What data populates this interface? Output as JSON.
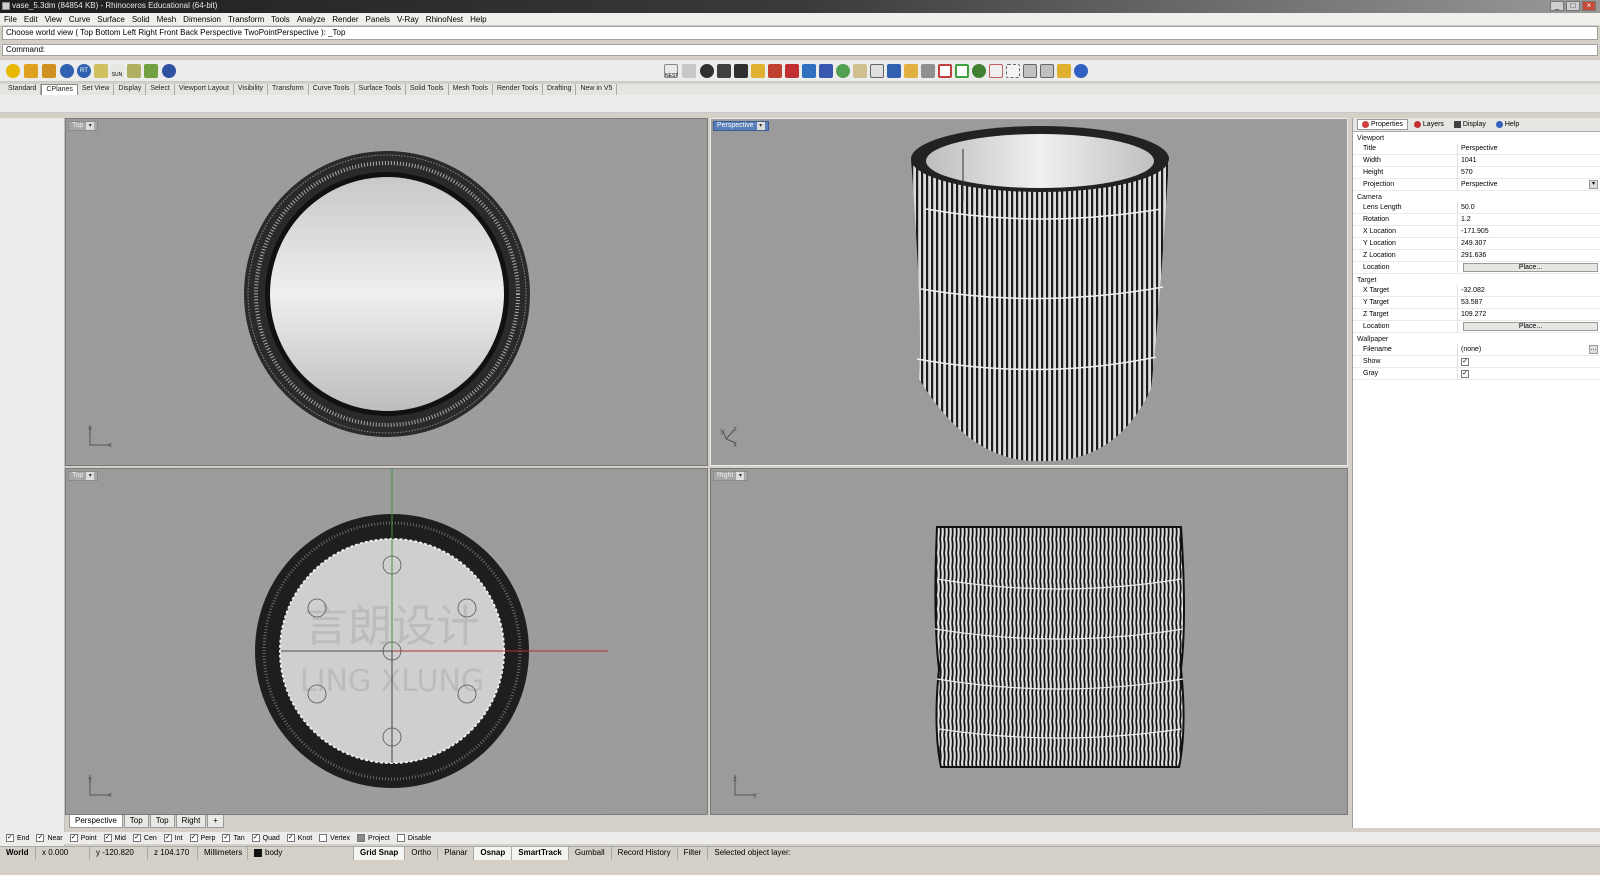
{
  "window": {
    "title": "vase_5.3dm (84854 KB) - Rhinoceros Educational (64-bit)",
    "controls": [
      "_",
      "□",
      "×"
    ]
  },
  "menu": [
    "File",
    "Edit",
    "View",
    "Curve",
    "Surface",
    "Solid",
    "Mesh",
    "Dimension",
    "Transform",
    "Tools",
    "Analyze",
    "Render",
    "Panels",
    "V-Ray",
    "RhinoNest",
    "Help"
  ],
  "command_history": "Choose world view ( Top  Bottom  Left  Right  Front  Back  Perspective  TwoPointPerspective ): _Top",
  "command_prompt": "Command:",
  "toolbar_tabs": [
    "Standard",
    "CPlanes",
    "Set View",
    "Display",
    "Select",
    "Viewport Layout",
    "Visibility",
    "Transform",
    "Curve Tools",
    "Surface Tools",
    "Solid Tools",
    "Mesh Tools",
    "Render Tools",
    "Drafting",
    "New in V5"
  ],
  "active_toolbar_tab": "CPlanes",
  "std_toolbar_text": {
    "sun": "SUN",
    "rt": "RT",
    "next": "NEST"
  },
  "viewports": {
    "top_left": {
      "label": "Top"
    },
    "top_right": {
      "label": "Perspective"
    },
    "bottom_left": {
      "label": "Top"
    },
    "bottom_right": {
      "label": "Right"
    }
  },
  "axis_labels": {
    "x": "x",
    "y": "y",
    "z": "z"
  },
  "watermark": {
    "line1": "言朗设计",
    "line2": "LING XLUNG"
  },
  "viewport_tabs": [
    "Perspective",
    "Top",
    "Top",
    "Right",
    "+"
  ],
  "panel": {
    "tabs": [
      {
        "label": "Properties",
        "color": "#d04040"
      },
      {
        "label": "Layers",
        "color": "#c03030"
      },
      {
        "label": "Display",
        "color": "#404040"
      },
      {
        "label": "Help",
        "color": "#3060c0"
      }
    ],
    "sections": {
      "viewport": {
        "label": "Viewport",
        "rows": [
          {
            "k": "Title",
            "v": "Perspective"
          },
          {
            "k": "Width",
            "v": "1041"
          },
          {
            "k": "Height",
            "v": "570"
          },
          {
            "k": "Projection",
            "v": "Perspective"
          }
        ]
      },
      "camera": {
        "label": "Camera",
        "rows": [
          {
            "k": "Lens Length",
            "v": "50.0"
          },
          {
            "k": "Rotation",
            "v": "1.2"
          },
          {
            "k": "X Location",
            "v": "-171.905"
          },
          {
            "k": "Y Location",
            "v": "249.307"
          },
          {
            "k": "Z Location",
            "v": "291.636"
          }
        ],
        "location_label": "Location",
        "place_label": "Place..."
      },
      "target": {
        "label": "Target",
        "rows": [
          {
            "k": "X Target",
            "v": "-32.082"
          },
          {
            "k": "Y Target",
            "v": "53.587"
          },
          {
            "k": "Z Target",
            "v": "109.272"
          }
        ],
        "location_label": "Location",
        "place_label": "Place..."
      },
      "wallpaper": {
        "label": "Wallpaper",
        "filename_label": "Filename",
        "filename": "(none)",
        "show_label": "Show",
        "gray_label": "Gray",
        "show": true,
        "gray": true
      }
    }
  },
  "osnaps": [
    {
      "label": "End",
      "on": true
    },
    {
      "label": "Near",
      "on": true
    },
    {
      "label": "Point",
      "on": true
    },
    {
      "label": "Mid",
      "on": true
    },
    {
      "label": "Cen",
      "on": true
    },
    {
      "label": "Int",
      "on": true
    },
    {
      "label": "Perp",
      "on": true
    },
    {
      "label": "Tan",
      "on": true
    },
    {
      "label": "Quad",
      "on": true
    },
    {
      "label": "Knot",
      "on": true
    },
    {
      "label": "Vertex",
      "on": false
    },
    {
      "label": "Project",
      "on": false
    },
    {
      "label": "Disable",
      "on": false
    }
  ],
  "status": {
    "cplane": "World",
    "x": "x 0.000",
    "y": "y -120.820",
    "z": "z 104.170",
    "units": "Millimeters",
    "layer": "body",
    "grid_snap": "Grid Snap",
    "ortho": "Ortho",
    "planar": "Planar",
    "osnap": "Osnap",
    "smarttrack": "SmartTrack",
    "gumball": "Gumball",
    "record_history": "Record History",
    "filter": "Filter",
    "message": "Selected object layer:"
  }
}
